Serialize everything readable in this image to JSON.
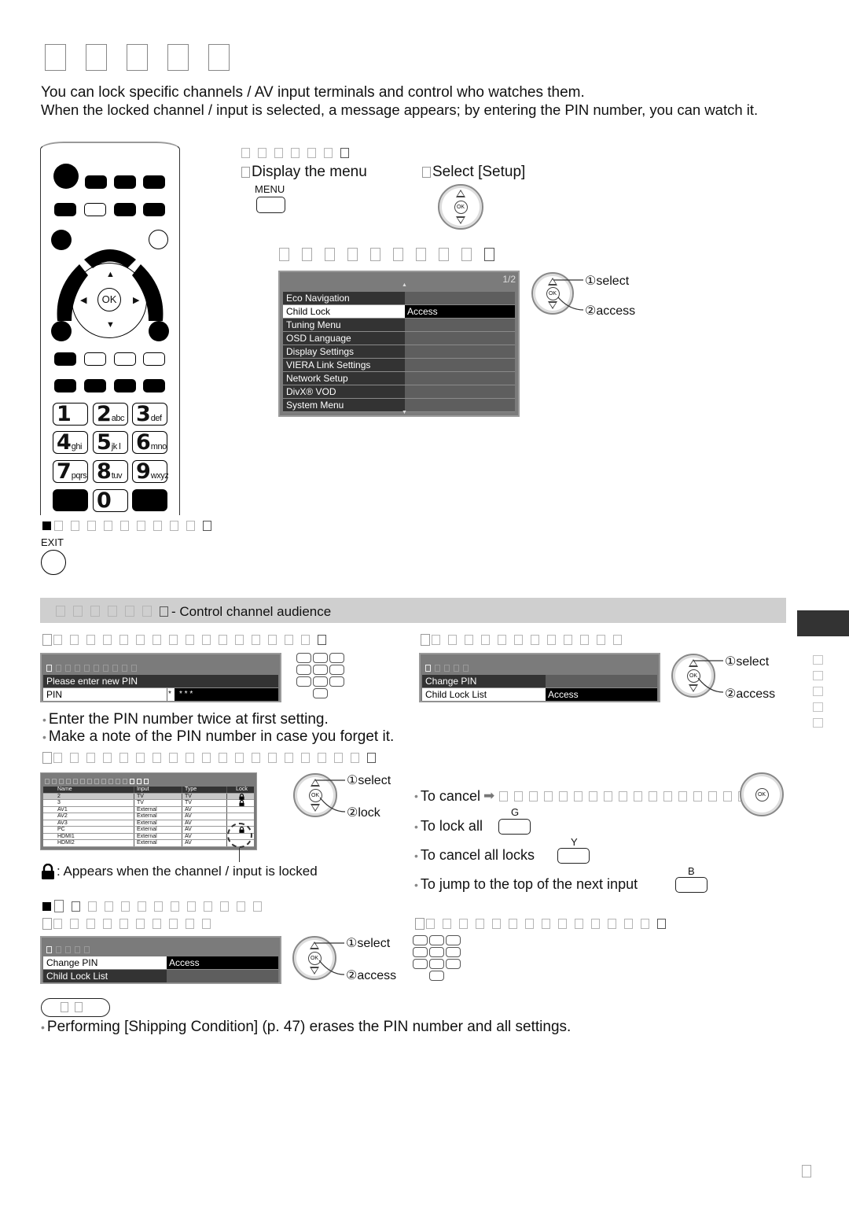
{
  "page": {
    "title_glyph_count": 5,
    "intro_line1": "You can lock specific channels / AV input terminals and control who watches them.",
    "intro_line2": "When the locked channel / input is selected, a message appears; by entering the PIN number, you can watch it.",
    "page_number_glyph": "□"
  },
  "step1": {
    "label": "Display the menu",
    "button_label": "MENU"
  },
  "step2": {
    "label": "Select [Setup]"
  },
  "setup_menu": {
    "page_indicator": "1/2",
    "items": [
      {
        "label": "Eco Navigation",
        "value": ""
      },
      {
        "label": "Child Lock",
        "value": "Access",
        "selected": true
      },
      {
        "label": "Tuning Menu",
        "value": ""
      },
      {
        "label": "OSD Language",
        "value": ""
      },
      {
        "label": "Display Settings",
        "value": ""
      },
      {
        "label": "VIERA Link Settings",
        "value": ""
      },
      {
        "label": "Network Setup",
        "value": ""
      },
      {
        "label": "DivX® VOD",
        "value": ""
      },
      {
        "label": "System Menu",
        "value": ""
      }
    ],
    "callout_select": "①select",
    "callout_access": "②access"
  },
  "exit": {
    "label": "EXIT"
  },
  "section_bar": {
    "subtitle": "- Control channel audience"
  },
  "pin_entry": {
    "row1_label": "Please enter new PIN",
    "row2_label": "PIN",
    "row2_value_first": "*",
    "row2_value_rest": "*  *  *",
    "note1": "Enter the PIN number twice at first setting.",
    "note2": "Make a note of the PIN number in case you forget it."
  },
  "child_lock_menu": {
    "items": [
      {
        "label": "Change PIN",
        "value": ""
      },
      {
        "label": "Child Lock List",
        "value": "Access",
        "selected": true
      }
    ],
    "callout_select": "①select",
    "callout_access": "②access"
  },
  "lock_list": {
    "columns": [
      "Name",
      "Input",
      "Type",
      "Lock"
    ],
    "rows": [
      {
        "name": "2",
        "input": "TV",
        "type": "TV",
        "locked": true,
        "highlight": true
      },
      {
        "name": "3",
        "input": "TV",
        "type": "TV",
        "locked": true
      },
      {
        "name": "AV1",
        "input": "External",
        "type": "AV",
        "locked": false
      },
      {
        "name": "AV2",
        "input": "External",
        "type": "AV",
        "locked": false
      },
      {
        "name": "AV3",
        "input": "External",
        "type": "AV",
        "locked": false
      },
      {
        "name": "PC",
        "input": "External",
        "type": "AV",
        "locked": true
      },
      {
        "name": "HDMI1",
        "input": "External",
        "type": "AV",
        "locked": false
      },
      {
        "name": "HDMI2",
        "input": "External",
        "type": "AV",
        "locked": false
      }
    ],
    "lock_legend": ": Appears when the channel / input is locked",
    "callout_select": "①select",
    "callout_lock": "②lock"
  },
  "lock_actions": {
    "to_cancel": "To cancel",
    "to_lock_all": "To lock all",
    "to_lock_all_key": "G",
    "to_cancel_all": "To cancel all locks",
    "to_cancel_all_key": "Y",
    "to_jump": "To jump to the top of the next input",
    "to_jump_key": "B"
  },
  "change_pin_menu": {
    "items": [
      {
        "label": "Change PIN",
        "value": "Access",
        "selected": true
      },
      {
        "label": "Child Lock List",
        "value": ""
      }
    ],
    "callout_select": "①select",
    "callout_access": "②access"
  },
  "note": {
    "text": "Performing [Shipping Condition] (p. 47) erases the PIN number and all settings."
  },
  "remote": {
    "ok_label": "OK",
    "numkeys": [
      {
        "digit": "1",
        "letters": ""
      },
      {
        "digit": "2",
        "letters": "abc"
      },
      {
        "digit": "3",
        "letters": "def"
      },
      {
        "digit": "4",
        "letters": "ghi"
      },
      {
        "digit": "5",
        "letters": "jk l"
      },
      {
        "digit": "6",
        "letters": "mno"
      },
      {
        "digit": "7",
        "letters": "pqrs"
      },
      {
        "digit": "8",
        "letters": "tuv"
      },
      {
        "digit": "9",
        "letters": "wxyz"
      },
      {
        "digit": "0",
        "letters": ""
      }
    ]
  },
  "colors": {
    "section_bar_bg": "#cfcfcf",
    "osd_bg": "#7b7b7b",
    "osd_row_dark": "#333333",
    "sidebar_tab": "#333333"
  }
}
